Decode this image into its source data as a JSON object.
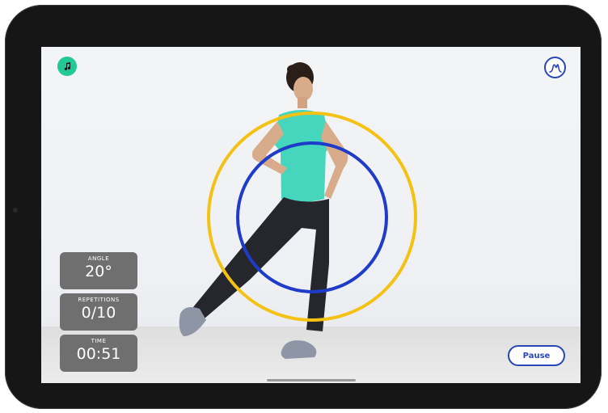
{
  "icons": {
    "music": "music-note-icon",
    "wave": "waveform-icon"
  },
  "colors": {
    "outer_circle": "#f4c214",
    "inner_circle": "#1e3cc8",
    "music_button": "#22c993",
    "accent": "#2a47b8",
    "stat_panel": "#6f6f6f"
  },
  "stats": [
    {
      "label": "ANGLE",
      "value": "20°"
    },
    {
      "label": "REPETITIONS",
      "value": "0/10"
    },
    {
      "label": "TIME",
      "value": "00:51"
    }
  ],
  "controls": {
    "pause_label": "Pause"
  }
}
